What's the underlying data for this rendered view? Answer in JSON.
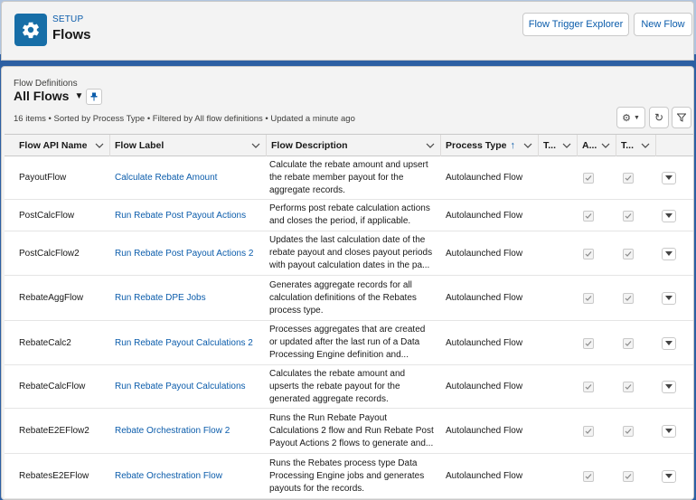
{
  "header": {
    "eyebrow": "SETUP",
    "title": "Flows",
    "buttons": {
      "trigger_explorer": "Flow Trigger Explorer",
      "new_flow": "New Flow"
    }
  },
  "list_view": {
    "eyebrow": "Flow Definitions",
    "title": "All Flows",
    "info": "16 items • Sorted by Process Type • Filtered by All flow definitions • Updated a minute ago"
  },
  "columns": {
    "api_name": "Flow API Name",
    "label": "Flow Label",
    "description": "Flow Description",
    "process_type": "Process Type",
    "col_t1": "T...",
    "col_a": "A...",
    "col_t2": "T..."
  },
  "rows": [
    {
      "api_name": "PayoutFlow",
      "label": "Calculate Rebate Amount",
      "desc": [
        "Calculate the rebate amount and upsert",
        "the rebate member payout for the",
        "aggregate records."
      ],
      "process_type": "Autolaunched Flow"
    },
    {
      "api_name": "PostCalcFlow",
      "label": "Run Rebate Post Payout Actions",
      "desc": [
        "Performs post rebate calculation actions",
        "and closes the period, if applicable."
      ],
      "process_type": "Autolaunched Flow"
    },
    {
      "api_name": "PostCalcFlow2",
      "label": "Run Rebate Post Payout Actions 2",
      "desc": [
        "Updates the last calculation date of the",
        "rebate payout and closes payout periods",
        "with payout calculation dates in the pa..."
      ],
      "process_type": "Autolaunched Flow"
    },
    {
      "api_name": "RebateAggFlow",
      "label": "Run Rebate DPE Jobs",
      "desc": [
        "Generates aggregate records for all",
        "calculation definitions of the Rebates",
        "process type."
      ],
      "process_type": "Autolaunched Flow"
    },
    {
      "api_name": "RebateCalc2",
      "label": "Run Rebate Payout Calculations 2",
      "desc": [
        "Processes aggregates that are created",
        "or updated after the last run of a Data",
        "Processing Engine definition and..."
      ],
      "process_type": "Autolaunched Flow"
    },
    {
      "api_name": "RebateCalcFlow",
      "label": "Run Rebate Payout Calculations",
      "desc": [
        "Calculates the rebate amount and",
        "upserts the rebate payout for the",
        "generated aggregate records."
      ],
      "process_type": "Autolaunched Flow"
    },
    {
      "api_name": "RebateE2EFlow2",
      "label": "Rebate Orchestration Flow 2",
      "desc": [
        "Runs the Run Rebate Payout",
        "Calculations 2 flow and Run Rebate Post",
        "Payout Actions 2 flows to generate and..."
      ],
      "process_type": "Autolaunched Flow"
    },
    {
      "api_name": "RebatesE2EFlow",
      "label": "Rebate Orchestration Flow",
      "desc": [
        "Runs the Rebates process type Data",
        "Processing Engine jobs and generates",
        "payouts for the records."
      ],
      "process_type": "Autolaunched Flow"
    }
  ]
}
